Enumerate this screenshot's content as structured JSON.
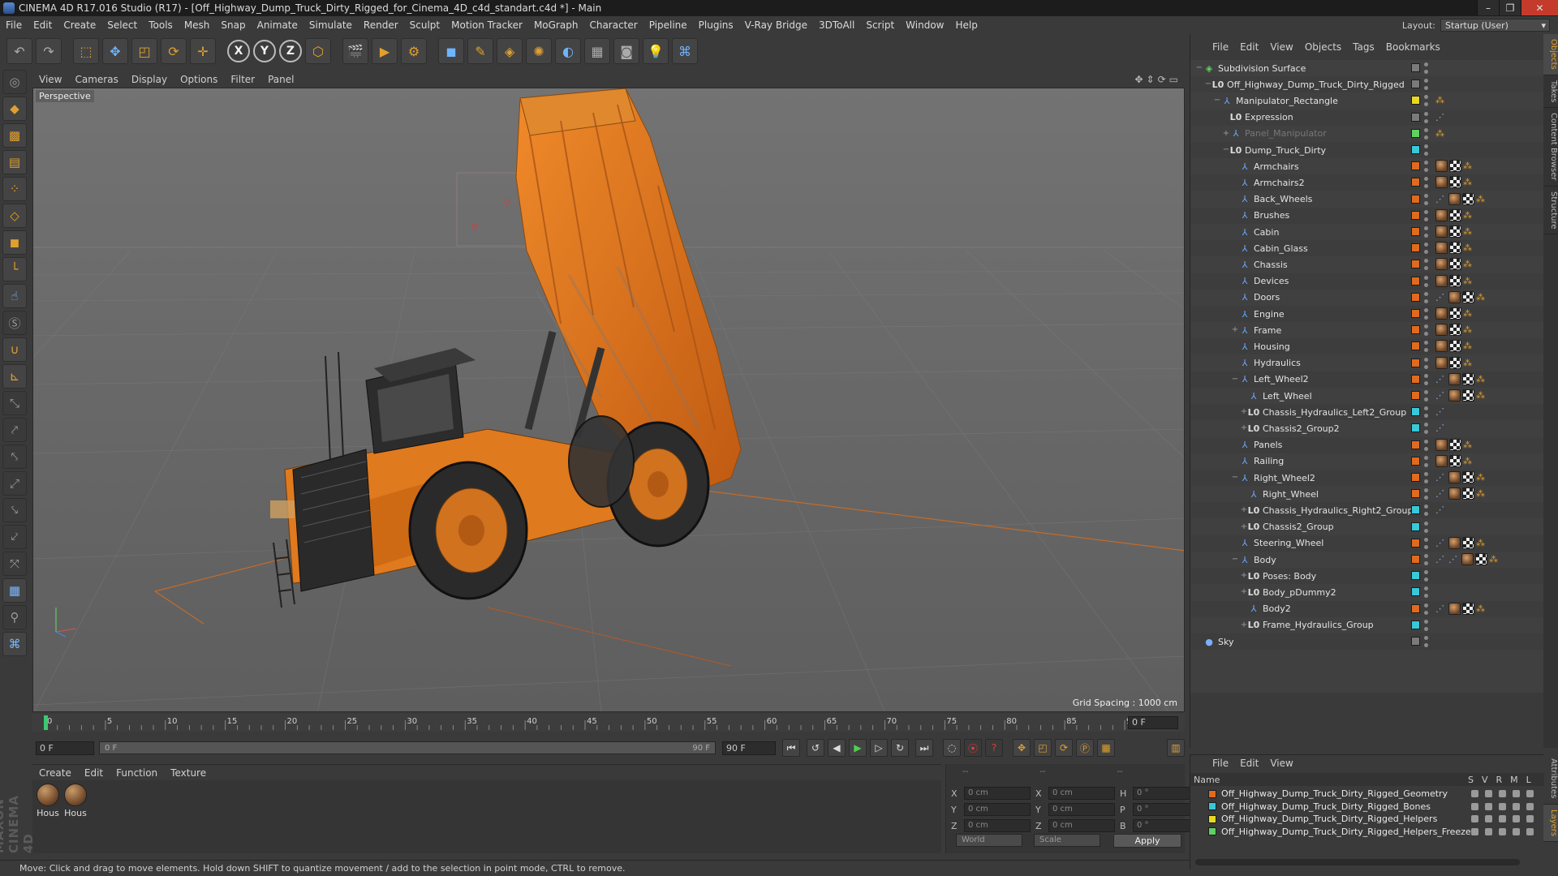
{
  "window": {
    "title": "CINEMA 4D R17.016 Studio (R17) - [Off_Highway_Dump_Truck_Dirty_Rigged_for_Cinema_4D_c4d_standart.c4d *] - Main"
  },
  "menubar": {
    "items": [
      "File",
      "Edit",
      "Create",
      "Select",
      "Tools",
      "Mesh",
      "Snap",
      "Animate",
      "Simulate",
      "Render",
      "Sculpt",
      "Motion Tracker",
      "MoGraph",
      "Character",
      "Pipeline",
      "Plugins",
      "V-Ray Bridge",
      "3DToAll",
      "Script",
      "Window",
      "Help"
    ],
    "layout_label": "Layout:",
    "layout_value": "Startup (User)"
  },
  "toolbar": {
    "x_label": "X",
    "y_label": "Y",
    "z_label": "Z"
  },
  "viewport": {
    "menu": [
      "View",
      "Cameras",
      "Display",
      "Options",
      "Filter",
      "Panel"
    ],
    "view_name": "Perspective",
    "grid_spacing": "Grid Spacing : 1000 cm"
  },
  "timeline": {
    "ticks": [
      "0",
      "5",
      "10",
      "15",
      "20",
      "25",
      "30",
      "35",
      "40",
      "45",
      "50",
      "55",
      "60",
      "65",
      "70",
      "75",
      "80",
      "85",
      "90"
    ],
    "current_frame": "0 F",
    "start_field": "0 F",
    "range_start": "0 F",
    "range_end": "90 F",
    "end_field": "90 F"
  },
  "materials": {
    "menu": [
      "Create",
      "Edit",
      "Function",
      "Texture"
    ],
    "items": [
      {
        "label": "Hous"
      },
      {
        "label": "Hous"
      }
    ]
  },
  "coordinates": {
    "header": [
      "--",
      "--",
      "--"
    ],
    "rows": [
      {
        "a": "X",
        "av": "0 cm",
        "b": "X",
        "bv": "0 cm",
        "c": "H",
        "cv": "0 °"
      },
      {
        "a": "Y",
        "av": "0 cm",
        "b": "Y",
        "bv": "0 cm",
        "c": "P",
        "cv": "0 °"
      },
      {
        "a": "Z",
        "av": "0 cm",
        "b": "Z",
        "bv": "0 cm",
        "c": "B",
        "cv": "0 °"
      }
    ],
    "mode": "World",
    "transform": "Scale",
    "apply": "Apply"
  },
  "status": "Move: Click and drag to move elements. Hold down SHIFT to quantize movement / add to the selection in point mode, CTRL to remove.",
  "object_manager": {
    "menu": [
      "File",
      "Edit",
      "View",
      "Objects",
      "Tags",
      "Bookmarks"
    ],
    "side_tabs": [
      "Objects",
      "Takes",
      "Content Browser",
      "Structure"
    ],
    "colors": {
      "orange": "#e06a1e",
      "cyan": "#38c8d8",
      "yellow": "#e8d820",
      "grey": "#7a7a7a",
      "green": "#60d060"
    },
    "objects": [
      {
        "name": "Subdivision Surface",
        "depth": 0,
        "icon": "sds",
        "expand": "−",
        "layer": "grey",
        "tags": []
      },
      {
        "name": "Off_Highway_Dump_Truck_Dirty_Rigged",
        "depth": 1,
        "icon": "null",
        "expand": "−",
        "layer": "grey",
        "tags": []
      },
      {
        "name": "Manipulator_Rectangle",
        "depth": 2,
        "icon": "bone",
        "expand": "−",
        "layer": "yellow",
        "tags": [
          "dot"
        ]
      },
      {
        "name": "Expression",
        "depth": 3,
        "icon": "null",
        "expand": "",
        "layer": "grey",
        "tags": [
          "ik"
        ]
      },
      {
        "name": "Panel_Manipulator",
        "depth": 3,
        "icon": "bone",
        "expand": "+",
        "layer": "green",
        "tags": [
          "dot"
        ],
        "dim": true
      },
      {
        "name": "Dump_Truck_Dirty",
        "depth": 3,
        "icon": "null",
        "expand": "−",
        "layer": "cyan",
        "tags": []
      },
      {
        "name": "Armchairs",
        "depth": 4,
        "icon": "bone",
        "expand": "",
        "layer": "orange",
        "tags": [
          "tex",
          "chk",
          "dot"
        ]
      },
      {
        "name": "Armchairs2",
        "depth": 4,
        "icon": "bone",
        "expand": "",
        "layer": "orange",
        "tags": [
          "tex",
          "chk",
          "dot"
        ]
      },
      {
        "name": "Back_Wheels",
        "depth": 4,
        "icon": "bone",
        "expand": "",
        "layer": "orange",
        "tags": [
          "ik",
          "tex",
          "chk",
          "dot"
        ]
      },
      {
        "name": "Brushes",
        "depth": 4,
        "icon": "bone",
        "expand": "",
        "layer": "orange",
        "tags": [
          "tex",
          "chk",
          "dot"
        ]
      },
      {
        "name": "Cabin",
        "depth": 4,
        "icon": "bone",
        "expand": "",
        "layer": "orange",
        "tags": [
          "tex",
          "chk",
          "dot"
        ]
      },
      {
        "name": "Cabin_Glass",
        "depth": 4,
        "icon": "bone",
        "expand": "",
        "layer": "orange",
        "tags": [
          "tex",
          "chk",
          "dot"
        ]
      },
      {
        "name": "Chassis",
        "depth": 4,
        "icon": "bone",
        "expand": "",
        "layer": "orange",
        "tags": [
          "tex",
          "chk",
          "dot"
        ]
      },
      {
        "name": "Devices",
        "depth": 4,
        "icon": "bone",
        "expand": "",
        "layer": "orange",
        "tags": [
          "tex",
          "chk",
          "dot"
        ]
      },
      {
        "name": "Doors",
        "depth": 4,
        "icon": "bone",
        "expand": "",
        "layer": "orange",
        "tags": [
          "ik",
          "tex",
          "chk",
          "dot"
        ]
      },
      {
        "name": "Engine",
        "depth": 4,
        "icon": "bone",
        "expand": "",
        "layer": "orange",
        "tags": [
          "tex",
          "chk",
          "dot"
        ]
      },
      {
        "name": "Frame",
        "depth": 4,
        "icon": "bone",
        "expand": "+",
        "layer": "orange",
        "tags": [
          "tex",
          "chk",
          "dot"
        ]
      },
      {
        "name": "Housing",
        "depth": 4,
        "icon": "bone",
        "expand": "",
        "layer": "orange",
        "tags": [
          "tex",
          "chk",
          "dot"
        ]
      },
      {
        "name": "Hydraulics",
        "depth": 4,
        "icon": "bone",
        "expand": "",
        "layer": "orange",
        "tags": [
          "tex",
          "chk",
          "dot"
        ]
      },
      {
        "name": "Left_Wheel2",
        "depth": 4,
        "icon": "bone",
        "expand": "−",
        "layer": "orange",
        "tags": [
          "ik",
          "tex",
          "chk",
          "dot"
        ]
      },
      {
        "name": "Left_Wheel",
        "depth": 5,
        "icon": "bone",
        "expand": "",
        "layer": "orange",
        "tags": [
          "ik",
          "tex",
          "chk",
          "dot"
        ]
      },
      {
        "name": "Chassis_Hydraulics_Left2_Group",
        "depth": 5,
        "icon": "null",
        "expand": "+",
        "layer": "cyan",
        "tags": [
          "ik"
        ]
      },
      {
        "name": "Chassis2_Group2",
        "depth": 5,
        "icon": "null",
        "expand": "+",
        "layer": "cyan",
        "tags": [
          "ik"
        ]
      },
      {
        "name": "Panels",
        "depth": 4,
        "icon": "bone",
        "expand": "",
        "layer": "orange",
        "tags": [
          "tex",
          "chk",
          "dot"
        ]
      },
      {
        "name": "Railing",
        "depth": 4,
        "icon": "bone",
        "expand": "",
        "layer": "orange",
        "tags": [
          "tex",
          "chk",
          "dot"
        ]
      },
      {
        "name": "Right_Wheel2",
        "depth": 4,
        "icon": "bone",
        "expand": "−",
        "layer": "orange",
        "tags": [
          "ik",
          "tex",
          "chk",
          "dot"
        ]
      },
      {
        "name": "Right_Wheel",
        "depth": 5,
        "icon": "bone",
        "expand": "",
        "layer": "orange",
        "tags": [
          "ik",
          "tex",
          "chk",
          "dot"
        ]
      },
      {
        "name": "Chassis_Hydraulics_Right2_Group",
        "depth": 5,
        "icon": "null",
        "expand": "+",
        "layer": "cyan",
        "tags": [
          "ik"
        ]
      },
      {
        "name": "Chassis2_Group",
        "depth": 5,
        "icon": "null",
        "expand": "+",
        "layer": "cyan",
        "tags": []
      },
      {
        "name": "Steering_Wheel",
        "depth": 4,
        "icon": "bone",
        "expand": "",
        "layer": "orange",
        "tags": [
          "ik",
          "tex",
          "chk",
          "dot"
        ]
      },
      {
        "name": "Body",
        "depth": 4,
        "icon": "bone",
        "expand": "−",
        "layer": "orange",
        "tags": [
          "ik",
          "ik",
          "tex",
          "chk",
          "dot"
        ]
      },
      {
        "name": "Poses: Body",
        "depth": 5,
        "icon": "null",
        "expand": "+",
        "layer": "cyan",
        "tags": []
      },
      {
        "name": "Body_pDummy2",
        "depth": 5,
        "icon": "null",
        "expand": "+",
        "layer": "cyan",
        "tags": []
      },
      {
        "name": "Body2",
        "depth": 5,
        "icon": "bone",
        "expand": "",
        "layer": "orange",
        "tags": [
          "ik",
          "tex",
          "chk",
          "dot"
        ]
      },
      {
        "name": "Frame_Hydraulics_Group",
        "depth": 5,
        "icon": "null",
        "expand": "+",
        "layer": "cyan",
        "tags": []
      },
      {
        "name": "Sky",
        "depth": 0,
        "icon": "sky",
        "expand": "",
        "layer": "grey",
        "tags": []
      }
    ]
  },
  "layer_manager": {
    "menu": [
      "File",
      "Edit",
      "View"
    ],
    "header_name": "Name",
    "flags": [
      "S",
      "V",
      "R",
      "M",
      "L"
    ],
    "side_tabs": [
      "Attributes",
      "Layers"
    ],
    "layers": [
      {
        "name": "Off_Highway_Dump_Truck_Dirty_Rigged_Geometry",
        "color": "#e06a1e"
      },
      {
        "name": "Off_Highway_Dump_Truck_Dirty_Rigged_Bones",
        "color": "#38c8d8"
      },
      {
        "name": "Off_Highway_Dump_Truck_Dirty_Rigged_Helpers",
        "color": "#e8d820"
      },
      {
        "name": "Off_Highway_Dump_Truck_Dirty_Rigged_Helpers_Freeze",
        "color": "#60d060"
      }
    ]
  }
}
